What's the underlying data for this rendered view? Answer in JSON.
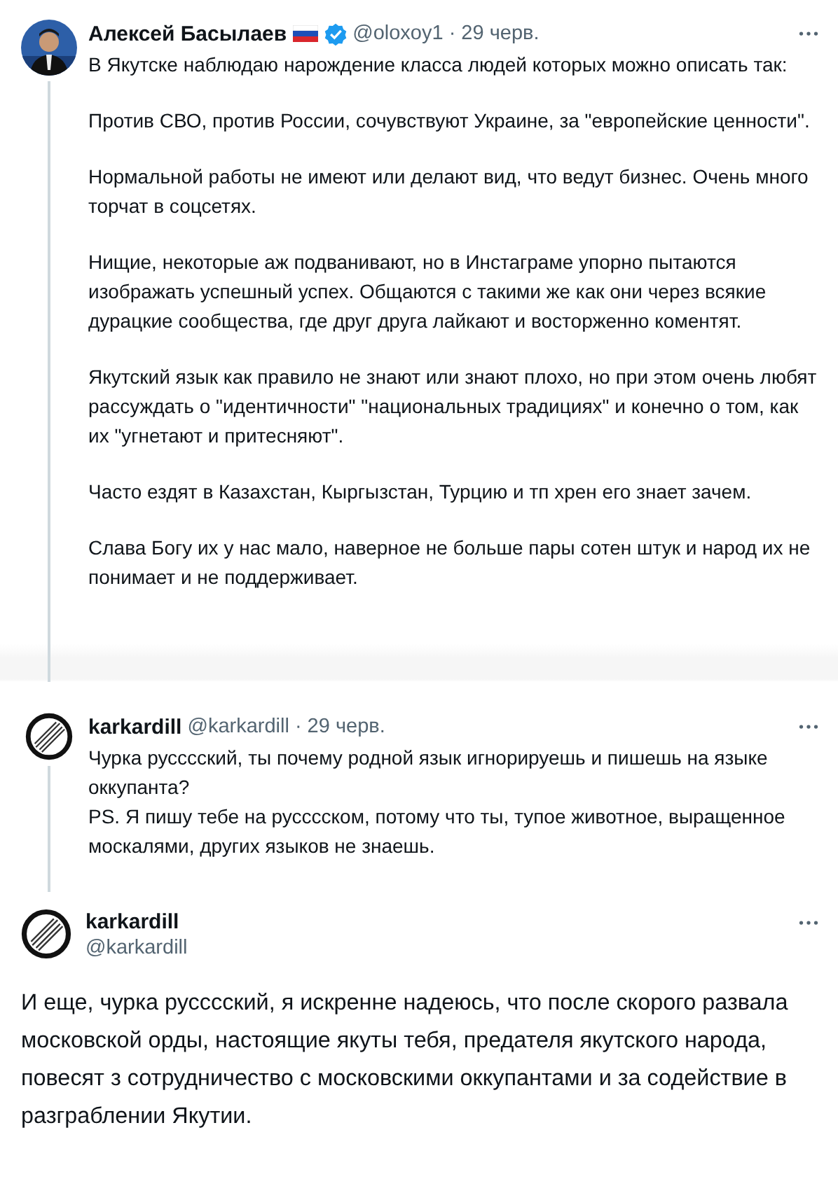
{
  "tweets": [
    {
      "kind": "thread",
      "photo_avatar": true,
      "name": "Алексей Басылаев",
      "flag": true,
      "verified": true,
      "handle": "@oloxoy1",
      "date": "· 29 черв.",
      "paragraphs": [
        "В Якутске наблюдаю нарождение класса людей которых можно описать так:",
        "Против СВО, против России, сочувствуют Украине, за \"европейские ценности\".",
        "Нормальной работы не имеют или делают вид, что ведут бизнес. Очень много торчат в соцсетях.",
        "Нищие, некоторые аж подванивают, но в Инстаграме упорно пытаются изображать успешный успех. Общаются с такими же как они через всякие дурацкие сообщества, где друг друга лайкают и восторженно коментят.",
        "Якутский язык как правило не знают или знают плохо, но при этом очень любят рассуждать о \"идентичности\" \"национальных традициях\" и конечно о том, как их \"угнетают и притесняют\".",
        "Часто ездят в Казахстан, Кыргызстан, Турцию и тп хрен его знает зачем.",
        "Слава Богу их у нас мало, наверное не больше пары сотен штук и народ их не понимает и не поддерживает."
      ]
    },
    {
      "kind": "thread",
      "photo_avatar": false,
      "name": "karkardill",
      "flag": false,
      "verified": false,
      "handle": "@karkardill",
      "date": "· 29 черв.",
      "paragraphs": [
        "Чурка русссский, ты почему родной язык игнорируешь и пишешь на языке оккупанта?\nPS. Я пишу тебе на русссском, потому что ты, тупое животное, выращенное москалями, других языков не знаешь."
      ]
    },
    {
      "kind": "focused",
      "photo_avatar": false,
      "name": "karkardill",
      "flag": false,
      "verified": false,
      "handle": "@karkardill",
      "paragraphs": [
        "И еще, чурка русссский, я искренне надеюсь, что после скорого развала московской орды, настоящие якуты тебя, предателя якутского народа, повесят з сотрудничество с московскими оккупантами и за содействие в разграблении Якутии."
      ]
    }
  ]
}
